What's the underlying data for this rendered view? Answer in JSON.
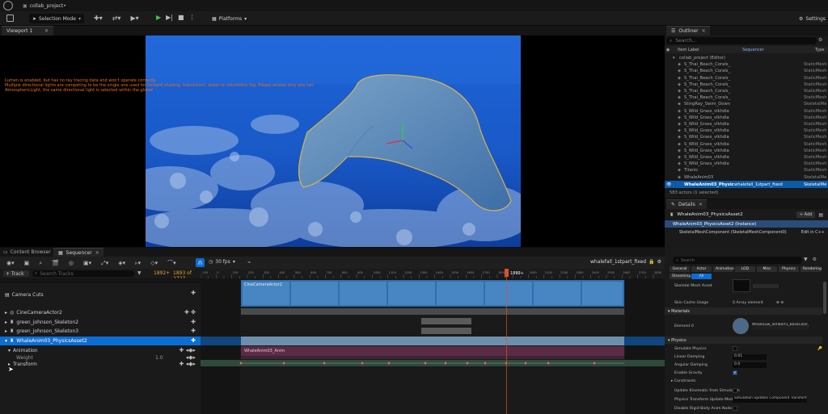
{
  "titlebar": {
    "project_tab": "collab_project•"
  },
  "toolbar": {
    "selection_mode": "Selection Mode",
    "platforms": "Platforms",
    "settings": "Settings"
  },
  "viewport": {
    "tab": "Viewport 1",
    "warnings": [
      "Lumen is enabled, but has no ray tracing data and won't operate correctly.",
      "Multiple directional lights are competing to be the single one used for forward shading, translucent, water or volumetric fog. Please ensure only one has",
      "AtmosphericLight, the same directional light is selected within the global",
      "Lumen ..."
    ]
  },
  "outliner": {
    "tab": "Outliner",
    "search_placeholder": "Search...",
    "col_item": "Item Label",
    "col_sequencer": "Sequencer",
    "col_type": "Type",
    "rows": [
      {
        "label": "collab_project (Editor)",
        "type": "",
        "indent": 1
      },
      {
        "label": "S_Thai_Beach_Corals_",
        "type": "StaticMesh",
        "indent": 2
      },
      {
        "label": "S_Thai_Beach_Corals_",
        "type": "StaticMesh",
        "indent": 2
      },
      {
        "label": "S_Thai_Beach_Corals_",
        "type": "StaticMesh",
        "indent": 2
      },
      {
        "label": "S_Thai_Beach_Corals_",
        "type": "StaticMesh",
        "indent": 2
      },
      {
        "label": "S_Thai_Beach_Corals_",
        "type": "StaticMesh",
        "indent": 2
      },
      {
        "label": "S_Thai_Beach_Corals_",
        "type": "StaticMesh",
        "indent": 2
      },
      {
        "label": "StingRay_Swim_Down",
        "type": "SkeletalMe",
        "indent": 2
      },
      {
        "label": "S_Wild_Grass_vlkhdia",
        "type": "StaticMesh",
        "indent": 2
      },
      {
        "label": "S_Wild_Grass_vlkhdia",
        "type": "StaticMesh",
        "indent": 2
      },
      {
        "label": "S_Wild_Grass_vlkhdia",
        "type": "StaticMesh",
        "indent": 2
      },
      {
        "label": "S_Wild_Grass_vlkhdia",
        "type": "StaticMesh",
        "indent": 2
      },
      {
        "label": "S_Wild_Grass_vlkhdia",
        "type": "StaticMesh",
        "indent": 2
      },
      {
        "label": "S_Wild_Grass_vlkhdia",
        "type": "StaticMesh",
        "indent": 2
      },
      {
        "label": "S_Wild_Grass_vlkhdia",
        "type": "StaticMesh",
        "indent": 2
      },
      {
        "label": "S_Wild_Grass_vlkhdia",
        "type": "StaticMesh",
        "indent": 2
      },
      {
        "label": "S_Wild_Grass_vlkhdia",
        "type": "StaticMesh",
        "indent": 2
      },
      {
        "label": "Titanic",
        "type": "StaticMesh",
        "indent": 2
      },
      {
        "label": "WhaleAnim03",
        "type": "SkeletalMe",
        "indent": 2
      }
    ],
    "selected_row": {
      "label": "WhaleAnim03_Physics",
      "sequencer": "whalefall_1stpart_fixed",
      "type": "SkeletalMe"
    },
    "footer": "583 actors (1 selected)"
  },
  "details": {
    "tab": "Details",
    "object": "WhaleAnim03_PhysicsAsset2",
    "add": "+ Add",
    "instance": "WhaleAnim03_PhysicsAsset2 (Instance)",
    "component": "SkeletalMeshComponent (SkeletalMeshComponent0)",
    "edit_cpp": "Edit in C++",
    "search_placeholder": "Search",
    "filter_tabs": [
      "General",
      "Actor",
      "Animation",
      "LOD",
      "Misc",
      "Physics",
      "Rendering",
      "Streaming",
      "All"
    ],
    "rows": {
      "skeletal_mesh_asset": "Skeletal Mesh Asset",
      "skin_cache_usage": "Skin Cache Usage",
      "skin_cache_value": "0 Array element",
      "materials": "Materials",
      "element0": "Element 0",
      "element0_value": "WhaleLow_lambert1_BaseColor_Mat",
      "physics": "Physics",
      "simulate_physics": "Simulate Physics",
      "linear_damping": "Linear Damping",
      "linear_damping_value": "0.01",
      "angular_damping": "Angular Damping",
      "angular_damping_value": "0.0",
      "enable_gravity": "Enable Gravity",
      "constraints": "Constraints",
      "update_kinematic": "Update Kinematic from Simulation",
      "transform_mode": "Physics Transform Update Mode",
      "transform_mode_value": "Simulation Updates Component Transform",
      "disable_rigid": "Disable Rigid Body Anim Node"
    }
  },
  "sequencer": {
    "tab_content_browser": "Content Browser",
    "tab_sequencer": "Sequencer",
    "fps": "30 fps",
    "sequence_name": "whalefall_1stpart_fixed",
    "add_track": "+ Track",
    "search_placeholder": "Search Tracks",
    "current_frame": "1892+",
    "frame_range": "1893 of 2727",
    "playhead_label": "1892+",
    "ruler_ticks": [
      "-100",
      "-50",
      "0",
      "50",
      "100",
      "150",
      "200",
      "250",
      "300",
      "350",
      "400",
      "450",
      "500",
      "550",
      "600",
      "650",
      "700",
      "750",
      "800",
      "850",
      "900",
      "950",
      "1000",
      "1050",
      "1100",
      "1150",
      "1200",
      "1250",
      "1300",
      "1350",
      "1400",
      "1450",
      "1500",
      "1550",
      "1600",
      "1650",
      "1700",
      "1750",
      "1800",
      "1850",
      "1900",
      "1950",
      "2000",
      "2050",
      "2100",
      "2150",
      "2200",
      "2250",
      "2300",
      "2350",
      "2400",
      "2450",
      "2500",
      "2550",
      "2600",
      "2650",
      "2700",
      "2750",
      "2800"
    ],
    "tracks": {
      "camera_cuts": "Camera Cuts",
      "cine_camera": "CineCameraActor2",
      "green_johnson": "green_johnson_Skeleton2",
      "green_johnson3": "green_johnson_Skeleton3",
      "whale": "WhaleAnim03_PhysicsAsset2",
      "animation": "Animation",
      "weight": "Weight",
      "weight_value": "1.0",
      "transform": "Transform"
    },
    "clips": {
      "camera_shot": "CineCameraActor2",
      "whale_anim": "WhaleAnim03_Anim"
    }
  },
  "colors": {
    "accent_blue": "#0c6ed4",
    "play_green": "#3cc83c",
    "playhead_red": "#d8522b",
    "warning_orange": "#e8701a",
    "selection_yellow": "#c9b040"
  }
}
